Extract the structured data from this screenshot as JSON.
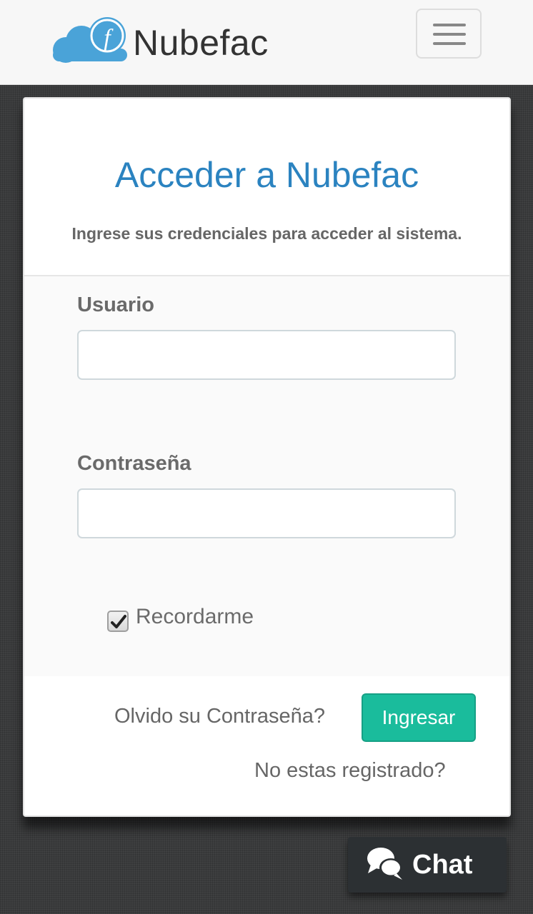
{
  "navbar": {
    "brand_name": "Nubefac",
    "logo_letter": "f"
  },
  "login": {
    "title": "Acceder a Nubefac",
    "subtitle": "Ingrese sus credenciales para acceder al sistema.",
    "username_label": "Usuario",
    "username_value": "",
    "password_label": "Contraseña",
    "password_value": "",
    "remember_label": "Recordarme",
    "remember_checked": true,
    "forgot_link": "Olvido su Contraseña?",
    "submit_label": "Ingresar",
    "register_link": "No estas registrado?"
  },
  "chat": {
    "label": "Chat"
  },
  "colors": {
    "brand_blue": "#2b83c0",
    "logo_cloud": "#4aa3d8",
    "submit_green": "#1abc9c",
    "chat_bg": "#2c3033"
  },
  "icons": [
    "cloud-logo-icon",
    "hamburger-menu-icon",
    "checkmark-icon",
    "chat-bubbles-icon"
  ]
}
